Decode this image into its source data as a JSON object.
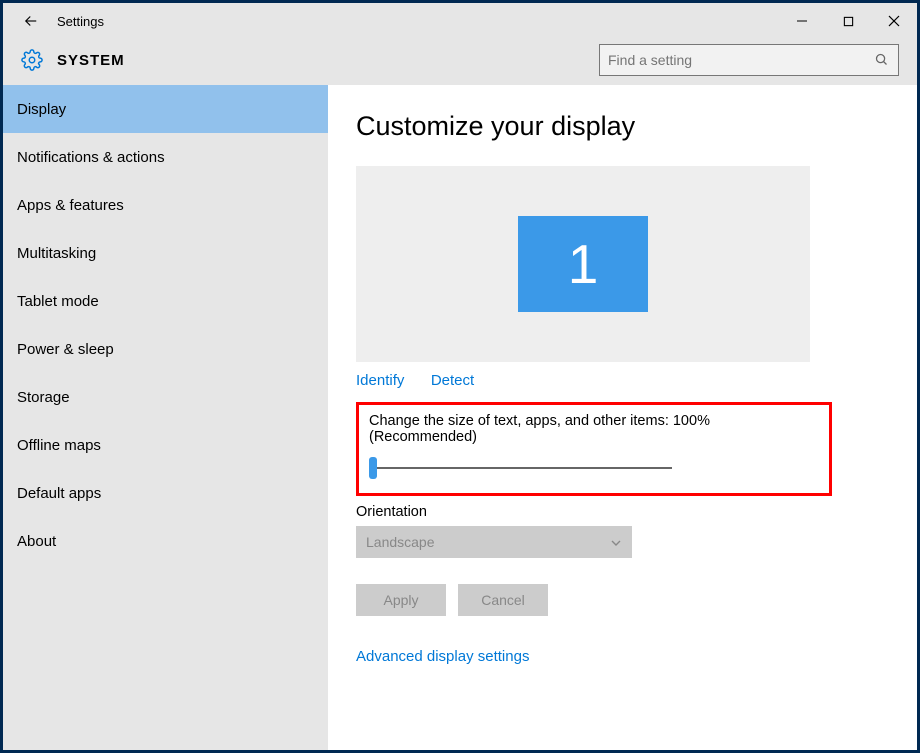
{
  "window": {
    "title": "Settings"
  },
  "header": {
    "section": "SYSTEM",
    "search_placeholder": "Find a setting"
  },
  "sidebar": {
    "items": [
      {
        "label": "Display",
        "selected": true
      },
      {
        "label": "Notifications & actions",
        "selected": false
      },
      {
        "label": "Apps & features",
        "selected": false
      },
      {
        "label": "Multitasking",
        "selected": false
      },
      {
        "label": "Tablet mode",
        "selected": false
      },
      {
        "label": "Power & sleep",
        "selected": false
      },
      {
        "label": "Storage",
        "selected": false
      },
      {
        "label": "Offline maps",
        "selected": false
      },
      {
        "label": "Default apps",
        "selected": false
      },
      {
        "label": "About",
        "selected": false
      }
    ]
  },
  "main": {
    "heading": "Customize your display",
    "monitor_number": "1",
    "identify_link": "Identify",
    "detect_link": "Detect",
    "scale_label": "Change the size of text, apps, and other items: 100% (Recommended)",
    "orientation_label": "Orientation",
    "orientation_value": "Landscape",
    "apply_button": "Apply",
    "cancel_button": "Cancel",
    "advanced_link": "Advanced display settings"
  }
}
